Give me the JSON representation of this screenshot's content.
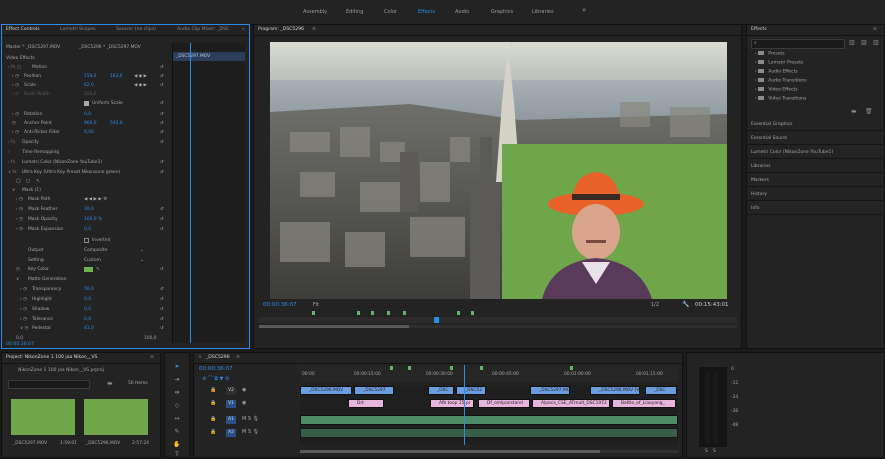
{
  "workspaces": [
    "Assembly",
    "Editing",
    "Color",
    "Effects",
    "Audio",
    "Graphics",
    "Libraries"
  ],
  "workspace_more": "»",
  "effect_controls": {
    "tabs": [
      "Effect Controls",
      "Lumetri Scopes",
      "Source: (no clips)",
      "Audio Clip Mixer: _DSC"
    ],
    "master": "Master * _DSC5297.MOV",
    "clip": "_DSC5296 * _DSC5297.MOV",
    "video_effects": "Video Effects",
    "motion": "Motion",
    "position": "Position",
    "position_x": "159,5",
    "position_y": "163,6",
    "scale": "Scale",
    "scale_val": "62,0",
    "scale_width": "Scale Width",
    "scale_width_val": "100,0",
    "uniform_scale": "Uniform Scale",
    "rotation": "Rotation",
    "rotation_val": "0,0",
    "anchor_point": "Anchor Point",
    "anchor_x": "960,0",
    "anchor_y": "540,0",
    "anti_flicker": "Anti-flicker Filter",
    "anti_flicker_val": "0,00",
    "opacity": "Opacity",
    "time_remapping": "Time Remapping",
    "lumetri": "Lumetri Color (NikonZone YouTube1)",
    "ultra_key": "Ultra Key (Ultra Key Preset Nikonzone green)",
    "mask": "Mask (1)",
    "mask_path": "Mask Path",
    "mask_feather": "Mask Feather",
    "mask_feather_val": "10,0",
    "mask_opacity": "Mask Opacity",
    "mask_opacity_val": "100,0 %",
    "mask_expansion": "Mask Expansion",
    "mask_expansion_val": "0,0",
    "inverted": "Inverted",
    "output": "Output",
    "output_val": "Composite",
    "setting": "Setting",
    "setting_val": "Custom",
    "key_color": "Key Color",
    "matte_generation": "Matte Generation",
    "transparency": "Transparency",
    "transparency_val": "50,0",
    "highlight": "Highlight",
    "highlight_val": "0,0",
    "shadow": "Shadow",
    "shadow_val": "0,0",
    "tolerance": "Tolerance",
    "tolerance_val": "0,0",
    "pedestal": "Pedestal",
    "pedestal_val": "41,0",
    "bottom_left": "0,0",
    "bottom_right": "100,0",
    "timecode": "00:00:36:07",
    "mini_clip": "_DSC5297.MOV"
  },
  "program": {
    "title": "Program: _DSC5296",
    "timecode": "00:00:36:07",
    "fit": "Fit",
    "fraction": "1/2",
    "duration": "00:15:43:01",
    "controls": [
      "▼",
      "{",
      "}",
      "|◀",
      "◀|",
      "▶",
      "|▶",
      "▶|",
      "⊞",
      "⊟",
      "◉",
      "▢",
      "⊡",
      "●",
      "⊕"
    ],
    "add": "+"
  },
  "effects_panel": {
    "title": "Effects",
    "items": [
      "Presets",
      "Lumetri Presets",
      "Audio Effects",
      "Audio Transitions",
      "Video Effects",
      "Video Transitions"
    ],
    "sections": [
      "Essential Graphics",
      "Essential Sound",
      "Lumetri Color (NikonZone YouTube1)",
      "Libraries",
      "Markers",
      "History",
      "Info"
    ]
  },
  "project": {
    "title": "Project: NikonZone 1 100 jaa Nikon__VS",
    "file": "NikonZone 1 100 jaa Nikon__VS.prproj",
    "items_count": "56 Items",
    "clips": [
      {
        "name": "_DSC5297.MOV",
        "duration": "1:59:01"
      },
      {
        "name": "_DSC5296.MOV",
        "duration": "2:57:24"
      }
    ]
  },
  "timeline": {
    "title": "_DSC5296",
    "timecode": "00:00:36:07",
    "ruler": [
      "00:00",
      "00:00:15:00",
      "00:00:30:00",
      "00:00:45:00",
      "00:01:00:00",
      "00:01:15:00"
    ],
    "tracks": [
      "V2",
      "V1",
      "A1",
      "A2"
    ],
    "v2_clips": [
      "_DSC5296.MOV",
      "_DSC5297",
      "_DSC",
      "_DSC52",
      "_DSC5297.MOV",
      "_DSC5296.MOV [V]",
      "_DSC"
    ],
    "v1_clips": [
      "Drt",
      "Afb toop 25.pr",
      "Df_omlpanstand",
      "Alpaca_CSE_ATmult_DSC1972",
      "Battle_of_Liaoyang_"
    ]
  },
  "meter": {
    "labels": [
      "0",
      "-12",
      "-24",
      "-36",
      "-48"
    ],
    "bottom": [
      "S",
      "S"
    ]
  },
  "colors": {
    "accent": "#2d8ceb",
    "green": "#6fb34f"
  }
}
